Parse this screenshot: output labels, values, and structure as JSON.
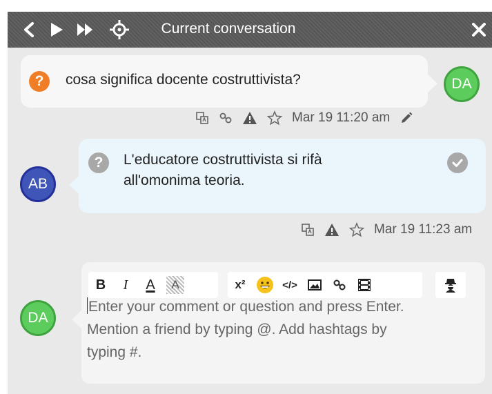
{
  "header": {
    "title": "Current conversation",
    "nav": {
      "back": "chevron-left-icon",
      "play": "play-icon",
      "fast_forward": "fast-forward-icon",
      "locate": "crosshair-icon",
      "close": "close-icon"
    }
  },
  "messages": [
    {
      "author_initials": "DA",
      "text": "cosa significa docente costruttivista?",
      "timestamp": "Mar 19 11:20 am",
      "status_color": "#f07e26"
    },
    {
      "author_initials": "AB",
      "text_line1": "L'educatore costruttivista si rifà",
      "text_line2": "all'omonima teoria.",
      "timestamp": "Mar 19 11:23 am",
      "status_color": "#a8a8a8"
    }
  ],
  "composer": {
    "author_initials": "DA",
    "placeholder_line1": "Enter your comment or question and press Enter.",
    "placeholder_line2": "Mention a friend by typing @. Add hashtags by",
    "placeholder_line3": "typing #.",
    "toolbar": {
      "bold": "B",
      "italic": "I",
      "font_color": "A",
      "highlight": "A",
      "superscript": "x²",
      "emoji": "emoji-icon",
      "code": "</>",
      "image": "image-icon",
      "link": "link-icon",
      "video": "film-icon",
      "anonymous": "spy-icon"
    }
  },
  "colors": {
    "header_bg": "#5a5a5a",
    "panel_bg": "#e9e9e9",
    "avatar_green": "#5ccc5c",
    "avatar_blue": "#3f55b8",
    "question_orange": "#f07e26",
    "answer_bubble": "#eaf5fc"
  }
}
